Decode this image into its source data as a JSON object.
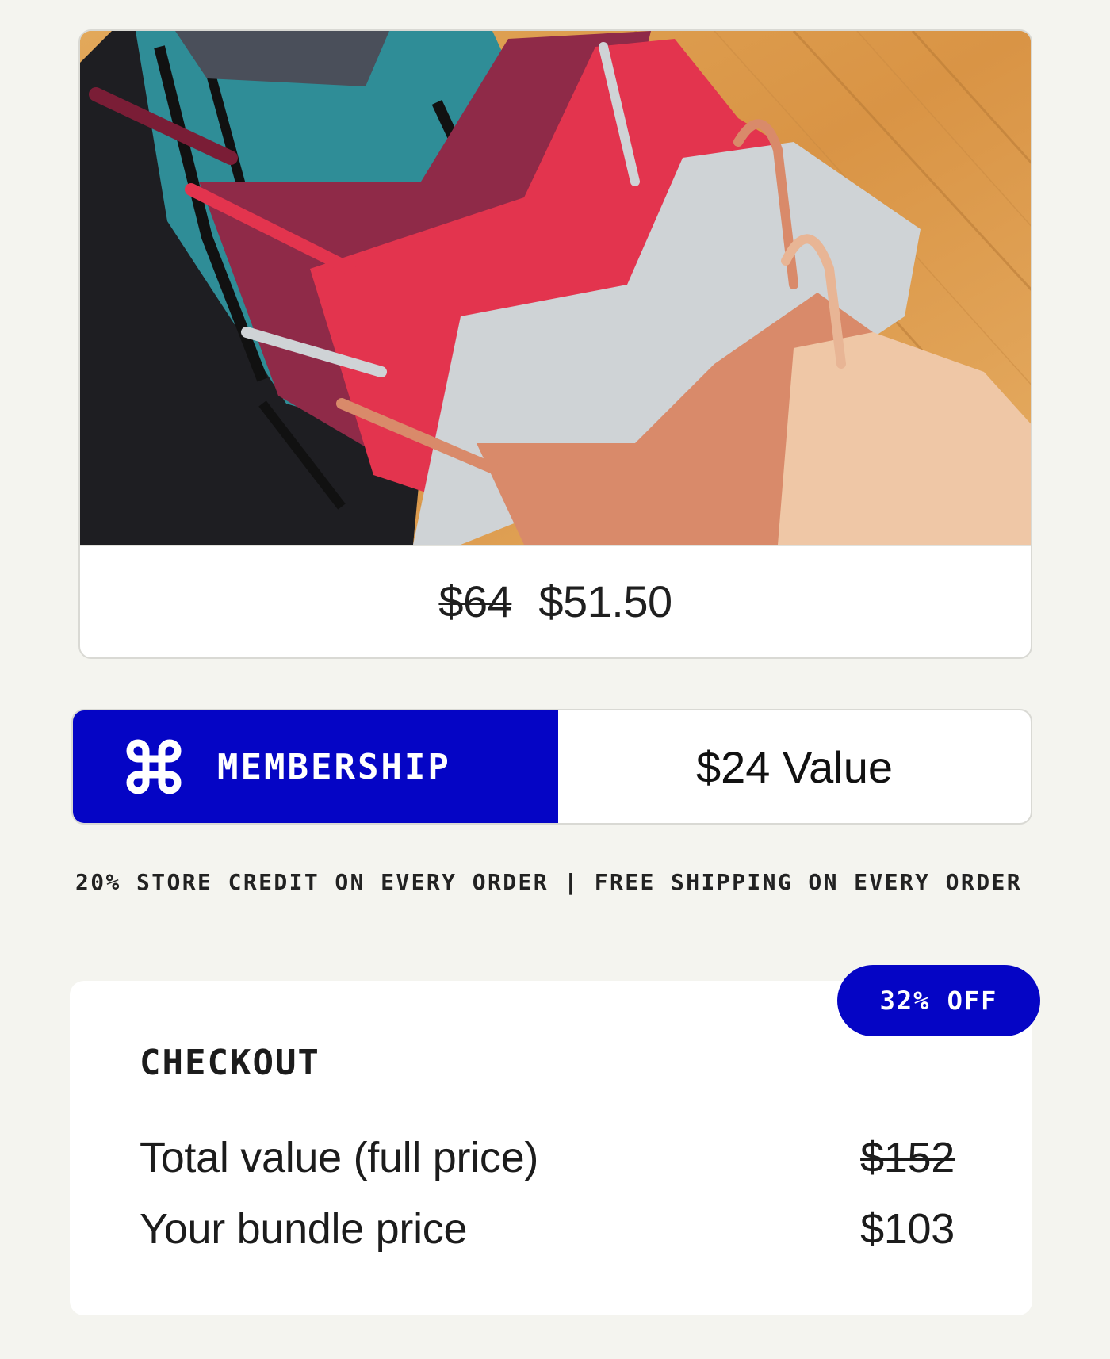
{
  "product": {
    "image_alt": "product-photo-bras",
    "original_price": "$64",
    "sale_price": "$51.50"
  },
  "membership": {
    "icon": "command-knot-icon",
    "label": "MEMBERSHIP",
    "value": "$24 Value",
    "accent_color": "#0505c5"
  },
  "perks": {
    "text": "20% STORE CREDIT ON EVERY ORDER | FREE SHIPPING ON EVERY ORDER"
  },
  "checkout": {
    "badge": "32% OFF",
    "title": "CHECKOUT",
    "rows": [
      {
        "label": "Total value (full price)",
        "value": "$152"
      },
      {
        "label": "Your bundle price",
        "value": "$103"
      }
    ]
  }
}
